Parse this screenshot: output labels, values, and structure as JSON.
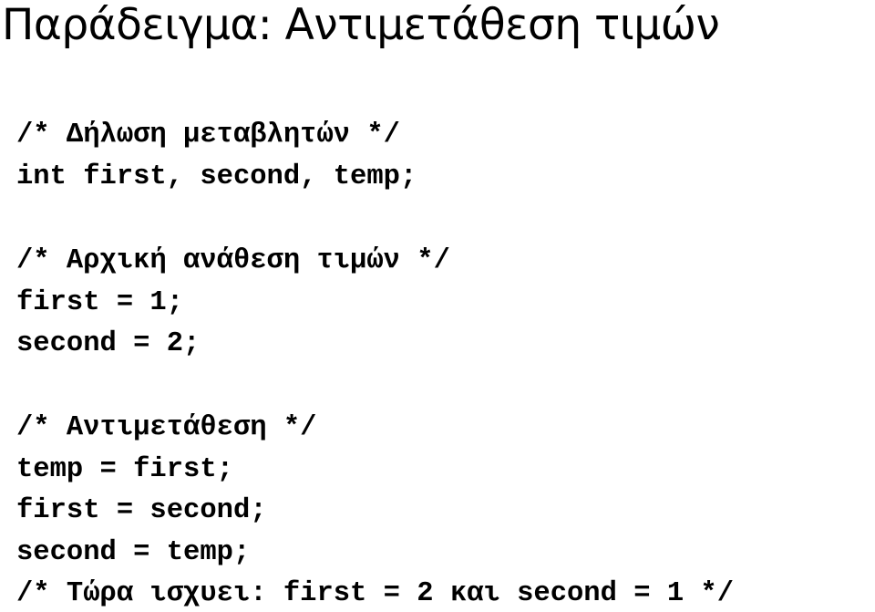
{
  "slide": {
    "title": "Παράδειγμα: Αντιμετάθεση τιμών",
    "code_lines": [
      "/* Δήλωση μεταβλητών */",
      "int first, second, temp;",
      "/* Αρχική ανάθεση τιμών */",
      "first = 1;",
      "second = 2;",
      "/* Αντιμετάθεση */",
      "temp = first;",
      "first = second;",
      "second = temp;",
      "/* Τώρα ισχυει: first = 2 και second = 1 */"
    ]
  }
}
